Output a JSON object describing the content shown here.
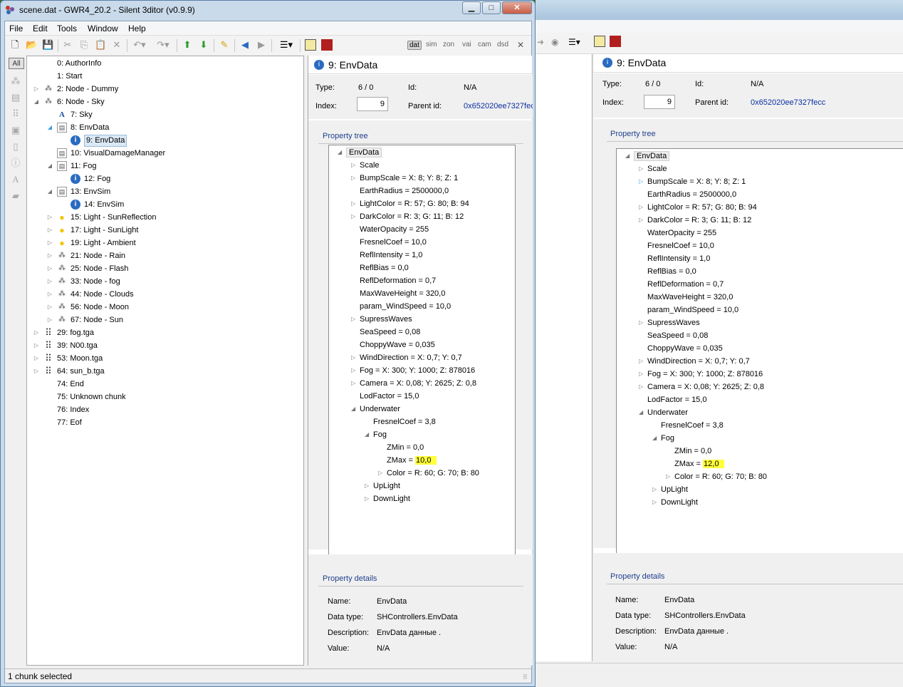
{
  "window": {
    "title": "scene.dat - GWR4_20.2 - Silent 3ditor (v0.9.9)",
    "minimize": "▁",
    "maximize": "□",
    "close": "✕"
  },
  "menu": [
    "File",
    "Edit",
    "Tools",
    "Window",
    "Help"
  ],
  "toolbar": {
    "modes": [
      "dat",
      "sim",
      "zon",
      "vai",
      "cam",
      "dsd"
    ],
    "active_mode": "dat",
    "close_label": "✕"
  },
  "icon_strip": {
    "all_label": "All"
  },
  "tree": [
    {
      "label": "0: AuthorInfo",
      "depth": 0,
      "icon": "none",
      "expander": "none"
    },
    {
      "label": "1: Start",
      "depth": 0,
      "icon": "none",
      "expander": "none"
    },
    {
      "label": "2: Node - Dummy",
      "depth": 0,
      "icon": "node-icon",
      "expander": "collapsed"
    },
    {
      "label": "6: Node - Sky",
      "depth": 0,
      "icon": "node-icon",
      "expander": "expanded"
    },
    {
      "label": "7: Sky",
      "depth": 1,
      "icon": "text-icon",
      "expander": "none"
    },
    {
      "label": "8: EnvData",
      "depth": 1,
      "icon": "document-icon",
      "expander": "expanded-blue"
    },
    {
      "label": "9: EnvData",
      "depth": 2,
      "icon": "info-icon",
      "expander": "none",
      "selected": true
    },
    {
      "label": "10: VisualDamageManager",
      "depth": 1,
      "icon": "document-icon",
      "expander": "none"
    },
    {
      "label": "11: Fog",
      "depth": 1,
      "icon": "document-icon",
      "expander": "expanded"
    },
    {
      "label": "12: Fog",
      "depth": 2,
      "icon": "info-icon",
      "expander": "none"
    },
    {
      "label": "13: EnvSim",
      "depth": 1,
      "icon": "document-icon",
      "expander": "expanded"
    },
    {
      "label": "14: EnvSim",
      "depth": 2,
      "icon": "info-icon",
      "expander": "none"
    },
    {
      "label": "15: Light - SunReflection",
      "depth": 1,
      "icon": "bulb-icon",
      "expander": "collapsed"
    },
    {
      "label": "17: Light - SunLight",
      "depth": 1,
      "icon": "bulb-icon",
      "expander": "collapsed"
    },
    {
      "label": "19: Light - Ambient",
      "depth": 1,
      "icon": "bulb-icon",
      "expander": "collapsed"
    },
    {
      "label": "21: Node - Rain",
      "depth": 1,
      "icon": "node-icon",
      "expander": "collapsed"
    },
    {
      "label": "25: Node - Flash",
      "depth": 1,
      "icon": "node-icon",
      "expander": "collapsed"
    },
    {
      "label": "33: Node - fog",
      "depth": 1,
      "icon": "node-icon",
      "expander": "collapsed"
    },
    {
      "label": "44: Node - Clouds",
      "depth": 1,
      "icon": "node-icon",
      "expander": "collapsed"
    },
    {
      "label": "56: Node - Moon",
      "depth": 1,
      "icon": "node-icon",
      "expander": "collapsed"
    },
    {
      "label": "67: Node - Sun",
      "depth": 1,
      "icon": "node-icon",
      "expander": "collapsed"
    },
    {
      "label": "29: fog.tga",
      "depth": 0,
      "icon": "texture-icon",
      "expander": "collapsed"
    },
    {
      "label": "39: N00.tga",
      "depth": 0,
      "icon": "texture-icon",
      "expander": "collapsed"
    },
    {
      "label": "53: Moon.tga",
      "depth": 0,
      "icon": "texture-icon",
      "expander": "collapsed"
    },
    {
      "label": "64: sun_b.tga",
      "depth": 0,
      "icon": "texture-icon",
      "expander": "collapsed"
    },
    {
      "label": "74: End",
      "depth": 0,
      "icon": "none",
      "expander": "none"
    },
    {
      "label": "75: Unknown chunk",
      "depth": 0,
      "icon": "none",
      "expander": "none"
    },
    {
      "label": "76: Index",
      "depth": 0,
      "icon": "none",
      "expander": "none"
    },
    {
      "label": "77: Eof",
      "depth": 0,
      "icon": "none",
      "expander": "none"
    }
  ],
  "panel": {
    "title": "9: EnvData",
    "type_label": "Type:",
    "type_value": "6 / 0",
    "id_label": "Id:",
    "id_value": "N/A",
    "index_label": "Index:",
    "index_value": "9",
    "parent_label": "Parent id:",
    "parent_value": "0x652020ee7327fecc",
    "property_tree_title": "Property tree",
    "property_details_title": "Property details",
    "details": [
      {
        "label": "Name:",
        "value": "EnvData"
      },
      {
        "label": "Data type:",
        "value": "SHControllers.EnvData"
      },
      {
        "label": "Description:",
        "value": "EnvData данные   ."
      },
      {
        "label": "Value:",
        "value": "N/A"
      }
    ]
  },
  "property_tree": [
    {
      "text": "EnvData",
      "depth": 0,
      "expander": "expanded",
      "root": true
    },
    {
      "text": "Scale",
      "depth": 1,
      "expander": "collapsed"
    },
    {
      "text": "BumpScale = X: 8; Y: 8; Z: 1",
      "depth": 1,
      "expander": "collapsed"
    },
    {
      "text": "EarthRadius = 2500000,0",
      "depth": 1,
      "expander": "none"
    },
    {
      "text": "LightColor = R: 57; G: 80; B: 94",
      "depth": 1,
      "expander": "collapsed"
    },
    {
      "text": "DarkColor = R: 3; G: 11; B: 12",
      "depth": 1,
      "expander": "collapsed"
    },
    {
      "text": "WaterOpacity = 255",
      "depth": 1,
      "expander": "none"
    },
    {
      "text": "FresnelCoef = 10,0",
      "depth": 1,
      "expander": "none"
    },
    {
      "text": "ReflIntensity = 1,0",
      "depth": 1,
      "expander": "none"
    },
    {
      "text": "ReflBias = 0,0",
      "depth": 1,
      "expander": "none"
    },
    {
      "text": "ReflDeformation = 0,7",
      "depth": 1,
      "expander": "none"
    },
    {
      "text": "MaxWaveHeight = 320,0",
      "depth": 1,
      "expander": "none"
    },
    {
      "text": "param_WindSpeed = 10,0",
      "depth": 1,
      "expander": "none"
    },
    {
      "text": "SupressWaves",
      "depth": 1,
      "expander": "collapsed"
    },
    {
      "text": "SeaSpeed = 0,08",
      "depth": 1,
      "expander": "none"
    },
    {
      "text": "ChoppyWave = 0,035",
      "depth": 1,
      "expander": "none"
    },
    {
      "text": "WindDirection = X: 0,7; Y: 0,7",
      "depth": 1,
      "expander": "collapsed"
    },
    {
      "text": "Fog = X: 300; Y: 1000; Z: 878016",
      "depth": 1,
      "expander": "collapsed"
    },
    {
      "text": "Camera = X: 0,08; Y: 2625; Z: 0,8",
      "depth": 1,
      "expander": "collapsed"
    },
    {
      "text": "LodFactor = 15,0",
      "depth": 1,
      "expander": "none"
    },
    {
      "text": "Underwater",
      "depth": 1,
      "expander": "expanded"
    },
    {
      "text": "FresnelCoef = 3,8",
      "depth": 2,
      "expander": "none"
    },
    {
      "text": "Fog",
      "depth": 2,
      "expander": "expanded"
    },
    {
      "text": "ZMin = 0,0",
      "depth": 3,
      "expander": "none"
    },
    {
      "text": "ZMax = ",
      "depth": 3,
      "expander": "none",
      "highlight": "10,0"
    },
    {
      "text": "Color = R: 60; G: 70; B: 80",
      "depth": 3,
      "expander": "collapsed"
    },
    {
      "text": "UpLight",
      "depth": 2,
      "expander": "collapsed"
    },
    {
      "text": "DownLight",
      "depth": 2,
      "expander": "collapsed"
    }
  ],
  "bg_window": {
    "panel_title": "9: EnvData",
    "type_value": "6 / 0",
    "id_value": "N/A",
    "index_value": "9",
    "parent_value": "0x652020ee7327fecc",
    "zmax_highlight": "12,0",
    "bumpscale_highlight_expander": true
  },
  "status": {
    "text": "1 chunk selected"
  },
  "colors": {
    "accent": "#1e3f8c",
    "highlight": "#ffff3a",
    "selection": "#dbe8f5"
  }
}
